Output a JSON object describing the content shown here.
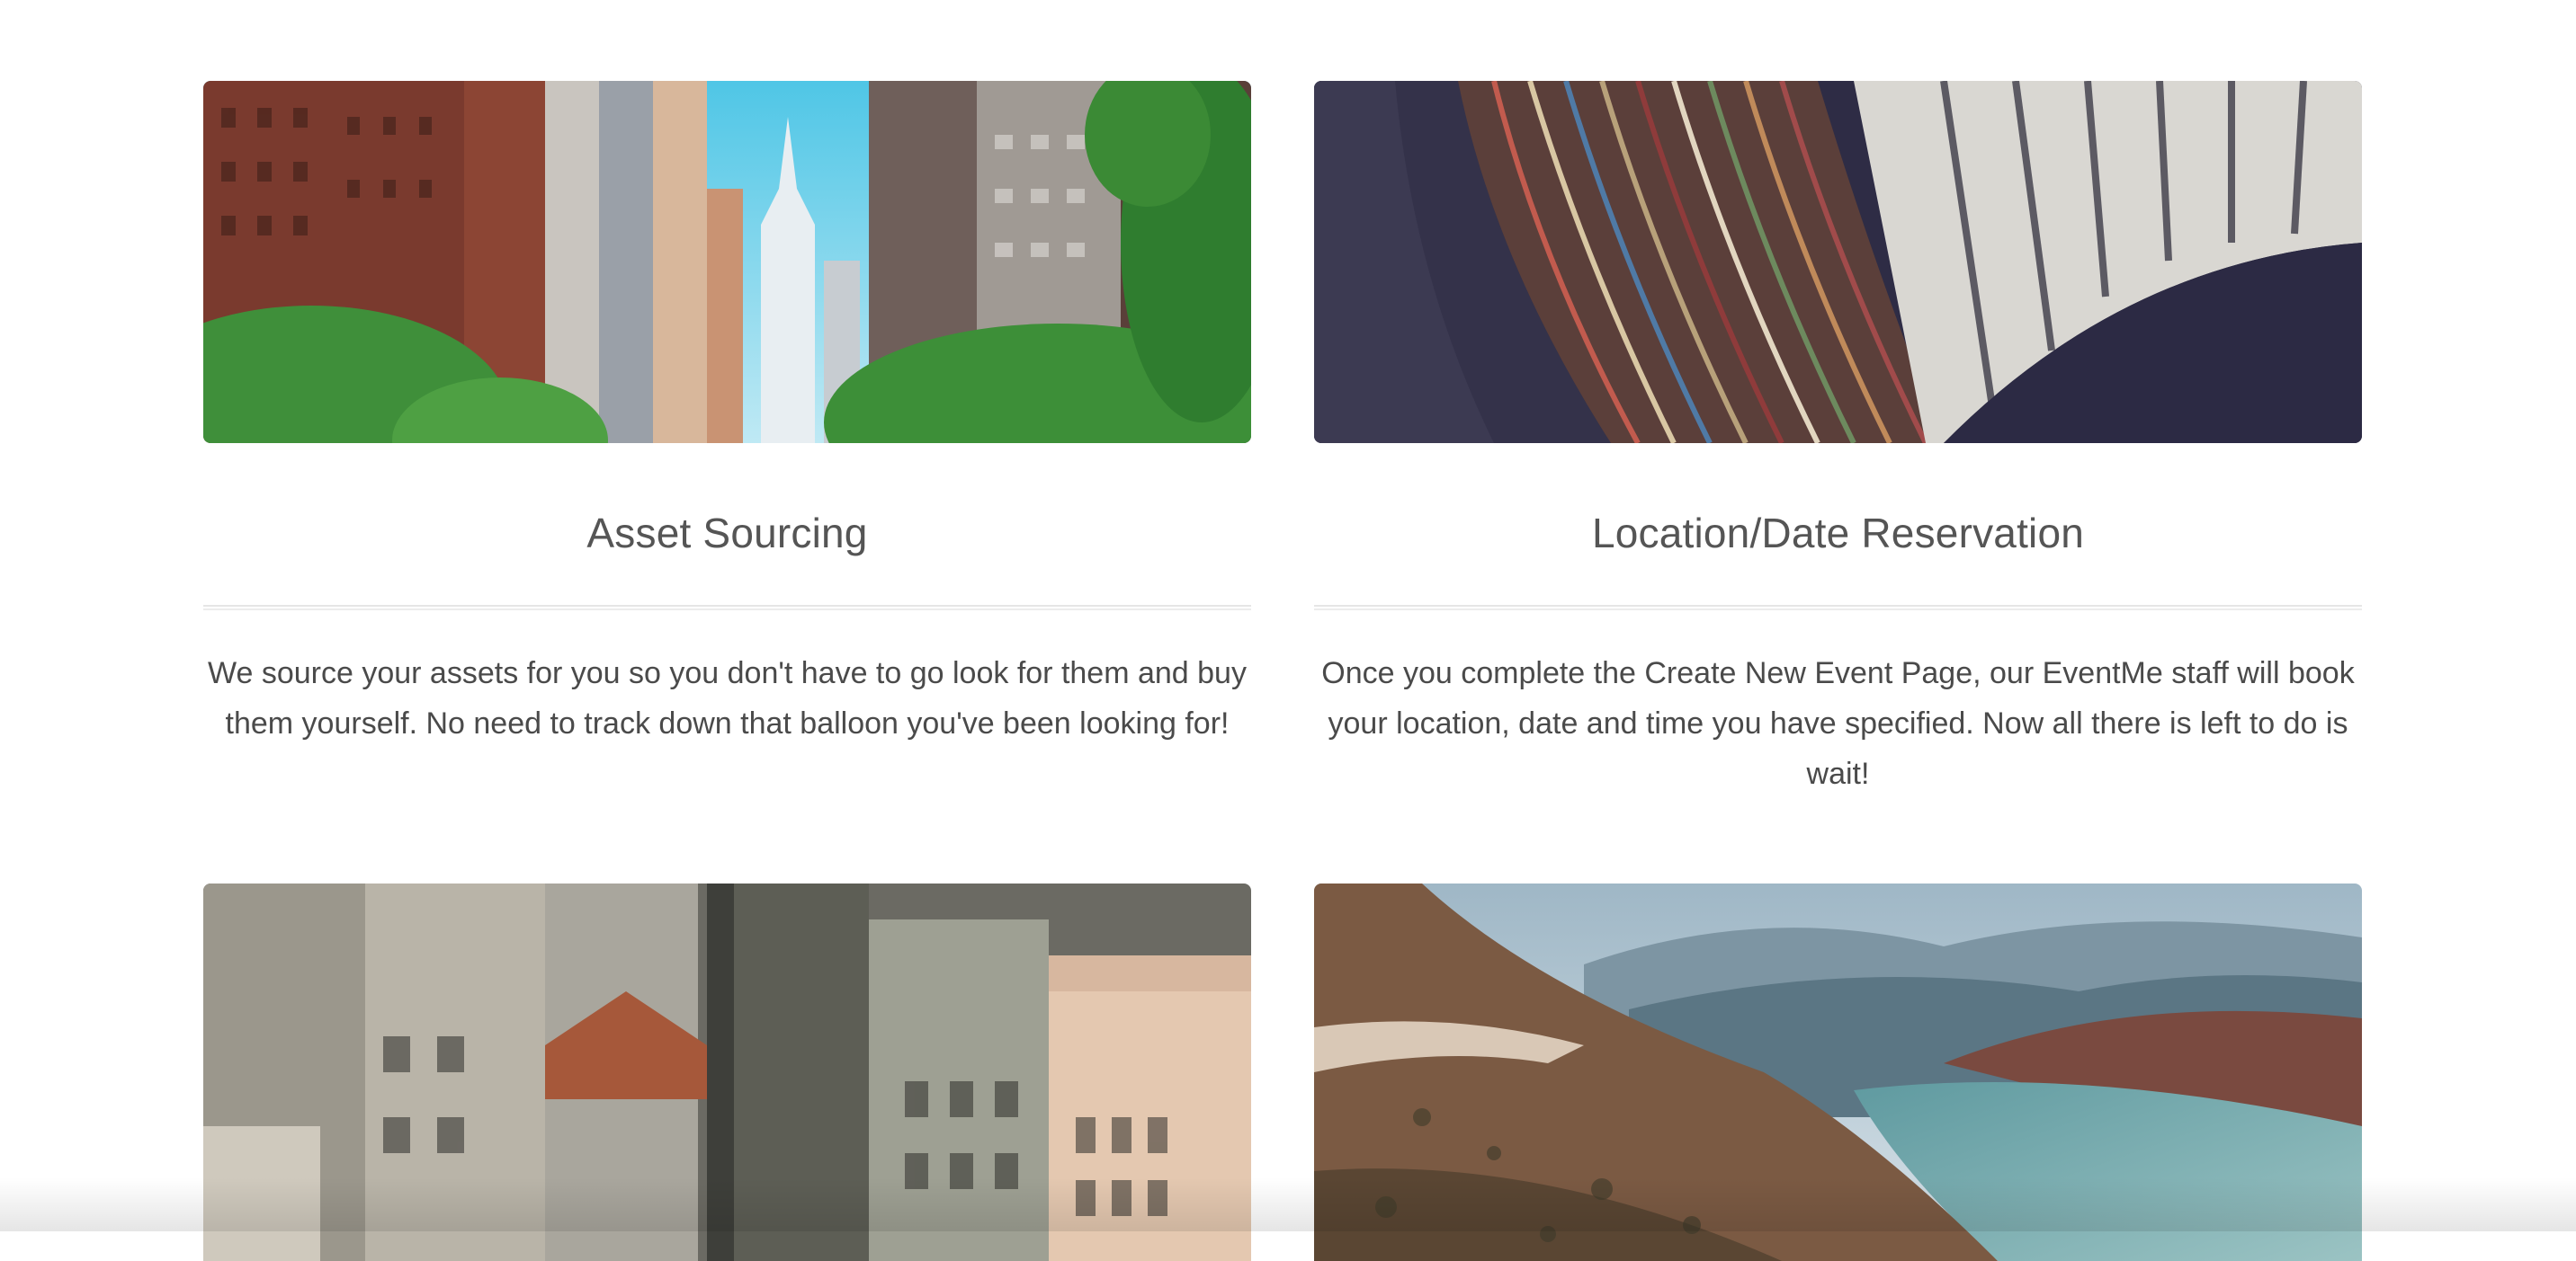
{
  "cards": [
    {
      "title": "Asset Sourcing",
      "description": "We source your assets for you so you don't have to go look for them and buy them yourself. No need to track down that balloon you've been looking for!",
      "image": "city-street-skyscrapers-photo"
    },
    {
      "title": "Location/Date Reservation",
      "description": "Once you complete the Create New Event Page, our EventMe staff will book your location, date and time you have specified. Now all there is left to do is wait!",
      "image": "library-bookshelves-photo"
    },
    {
      "image": "rooftops-aerial-photo"
    },
    {
      "image": "mountain-lake-road-photo"
    }
  ],
  "colors": {
    "title": "#555555",
    "text": "#4a4a4a",
    "divider": "#e6e6e6",
    "background": "#ffffff"
  }
}
